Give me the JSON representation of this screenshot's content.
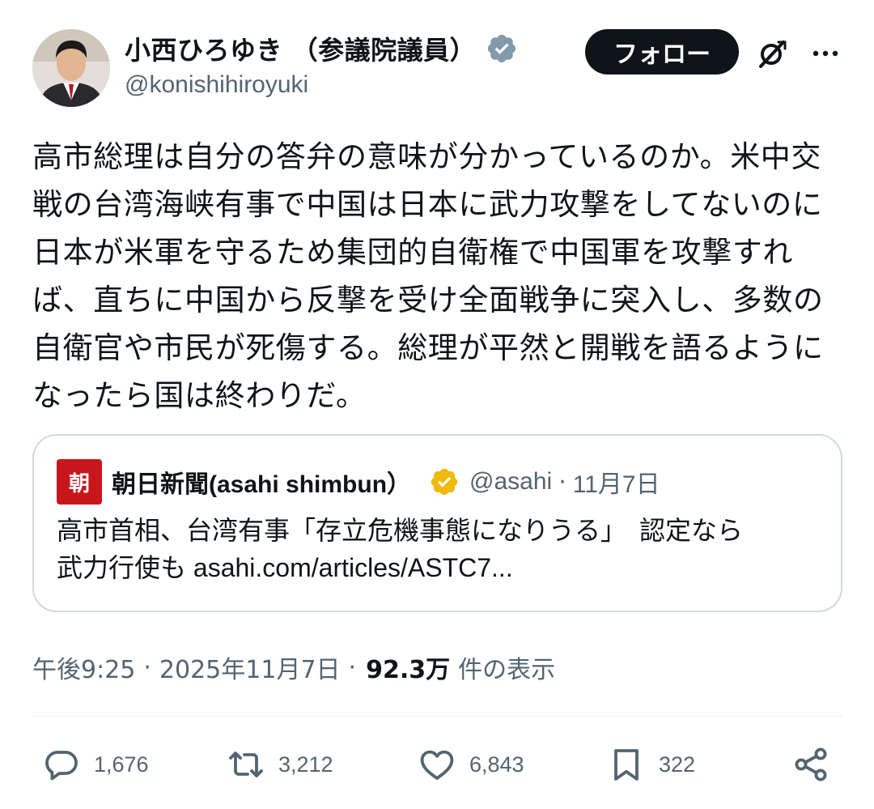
{
  "author": {
    "display_name": "小西ひろゆき （参議院議員）",
    "handle": "@konishihiroyuki",
    "avatar_icon": "avatar-photo",
    "verified_color": "#829aab"
  },
  "header": {
    "follow_label": "フォロー",
    "grok_icon": "grok-icon",
    "more_icon": "more-icon"
  },
  "tweet": {
    "text": "高市総理は自分の答弁の意味が分かっているのか。米中交戦の台湾海峡有事で中国は日本に武力攻撃をしてないのに日本が米軍を守るため集団的自衛権で中国軍を攻撃すれば、直ちに中国から反撃を受け全面戦争に突入し、多数の自衛官や市民が死傷する。総理が平然と開戦を語るようになったら国は終わりだ。"
  },
  "quote": {
    "logo_text": "朝",
    "name": "朝日新聞(asahi shimbun）",
    "handle": "@asahi",
    "dot": "·",
    "date": "11月7日",
    "text_line1": "高市首相、台湾有事「存立危機事態になりうる」　認定なら",
    "text_line2_prefix": "武力行使も ",
    "text_link": "asahi.com/articles/ASTC7...",
    "verified_color": "#f0b90b",
    "logo_color": "#c8161d"
  },
  "meta": {
    "time": "午後9:25",
    "sep1": "·",
    "date": "2025年11月7日",
    "sep2": "·",
    "views": "92.3万",
    "views_label": "件の表示"
  },
  "actions": {
    "replies": "1,676",
    "retweets": "3,212",
    "likes": "6,843",
    "bookmarks": "322"
  }
}
